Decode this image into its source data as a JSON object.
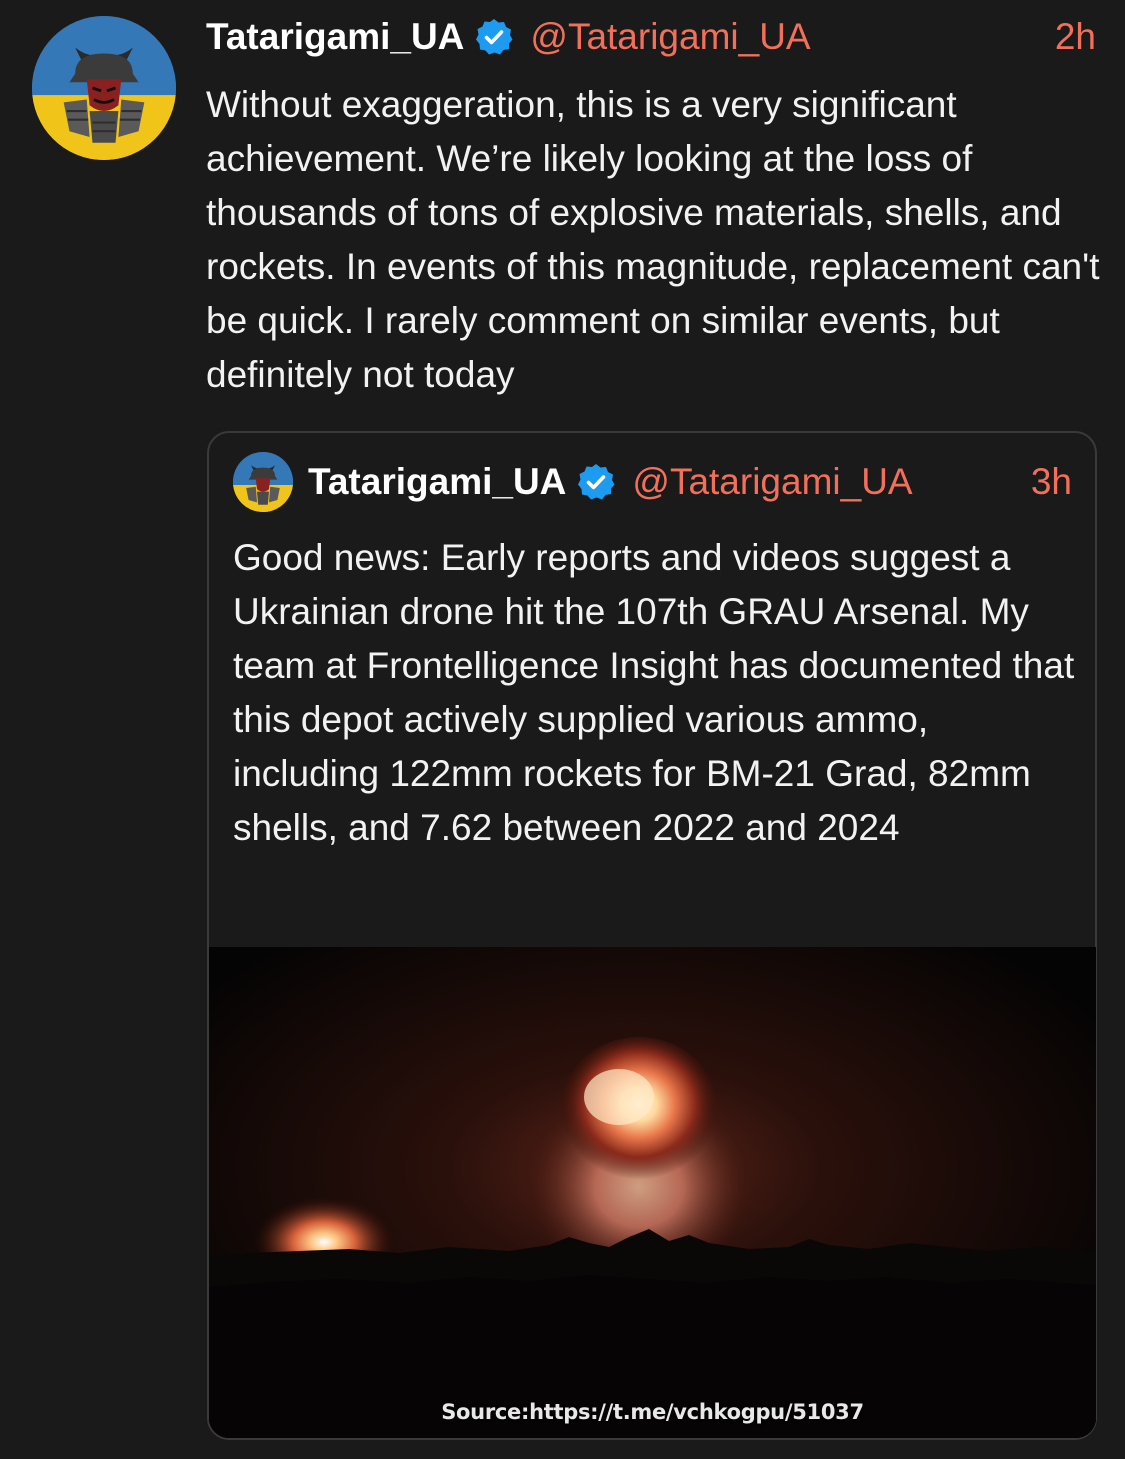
{
  "tweet": {
    "author": {
      "display_name": "Tatarigami_UA",
      "handle": "@Tatarigami_UA",
      "verified": true,
      "avatar_icon": "samurai-avatar-icon"
    },
    "time": "2h",
    "text": "Without exaggeration, this is a very significant achievement. We’re likely looking at the loss of thousands of tons of explosive materials, shells, and rockets. In events of this magnitude, replacement can't be quick. I rarely comment on similar events, but definitely not today"
  },
  "quoted_tweet": {
    "author": {
      "display_name": "Tatarigami_UA",
      "handle": "@Tatarigami_UA",
      "verified": true,
      "avatar_icon": "samurai-avatar-icon"
    },
    "time": "3h",
    "text": "Good news: Early reports and videos suggest a Ukrainian drone hit the 107th GRAU Arsenal. My team at Frontelligence Insight has documented that this depot actively supplied various ammo, including 122mm rockets for BM-21 Grad, 82mm shells, and 7.62 between 2022 and 2024",
    "media": {
      "caption": "Source:https://t.me/vchkogpu/51037"
    }
  },
  "colors": {
    "background": "#1a1a1a",
    "accent_handle": "#f2705a",
    "verified_badge": "#1d9bf0",
    "border": "#3a3a3a"
  }
}
